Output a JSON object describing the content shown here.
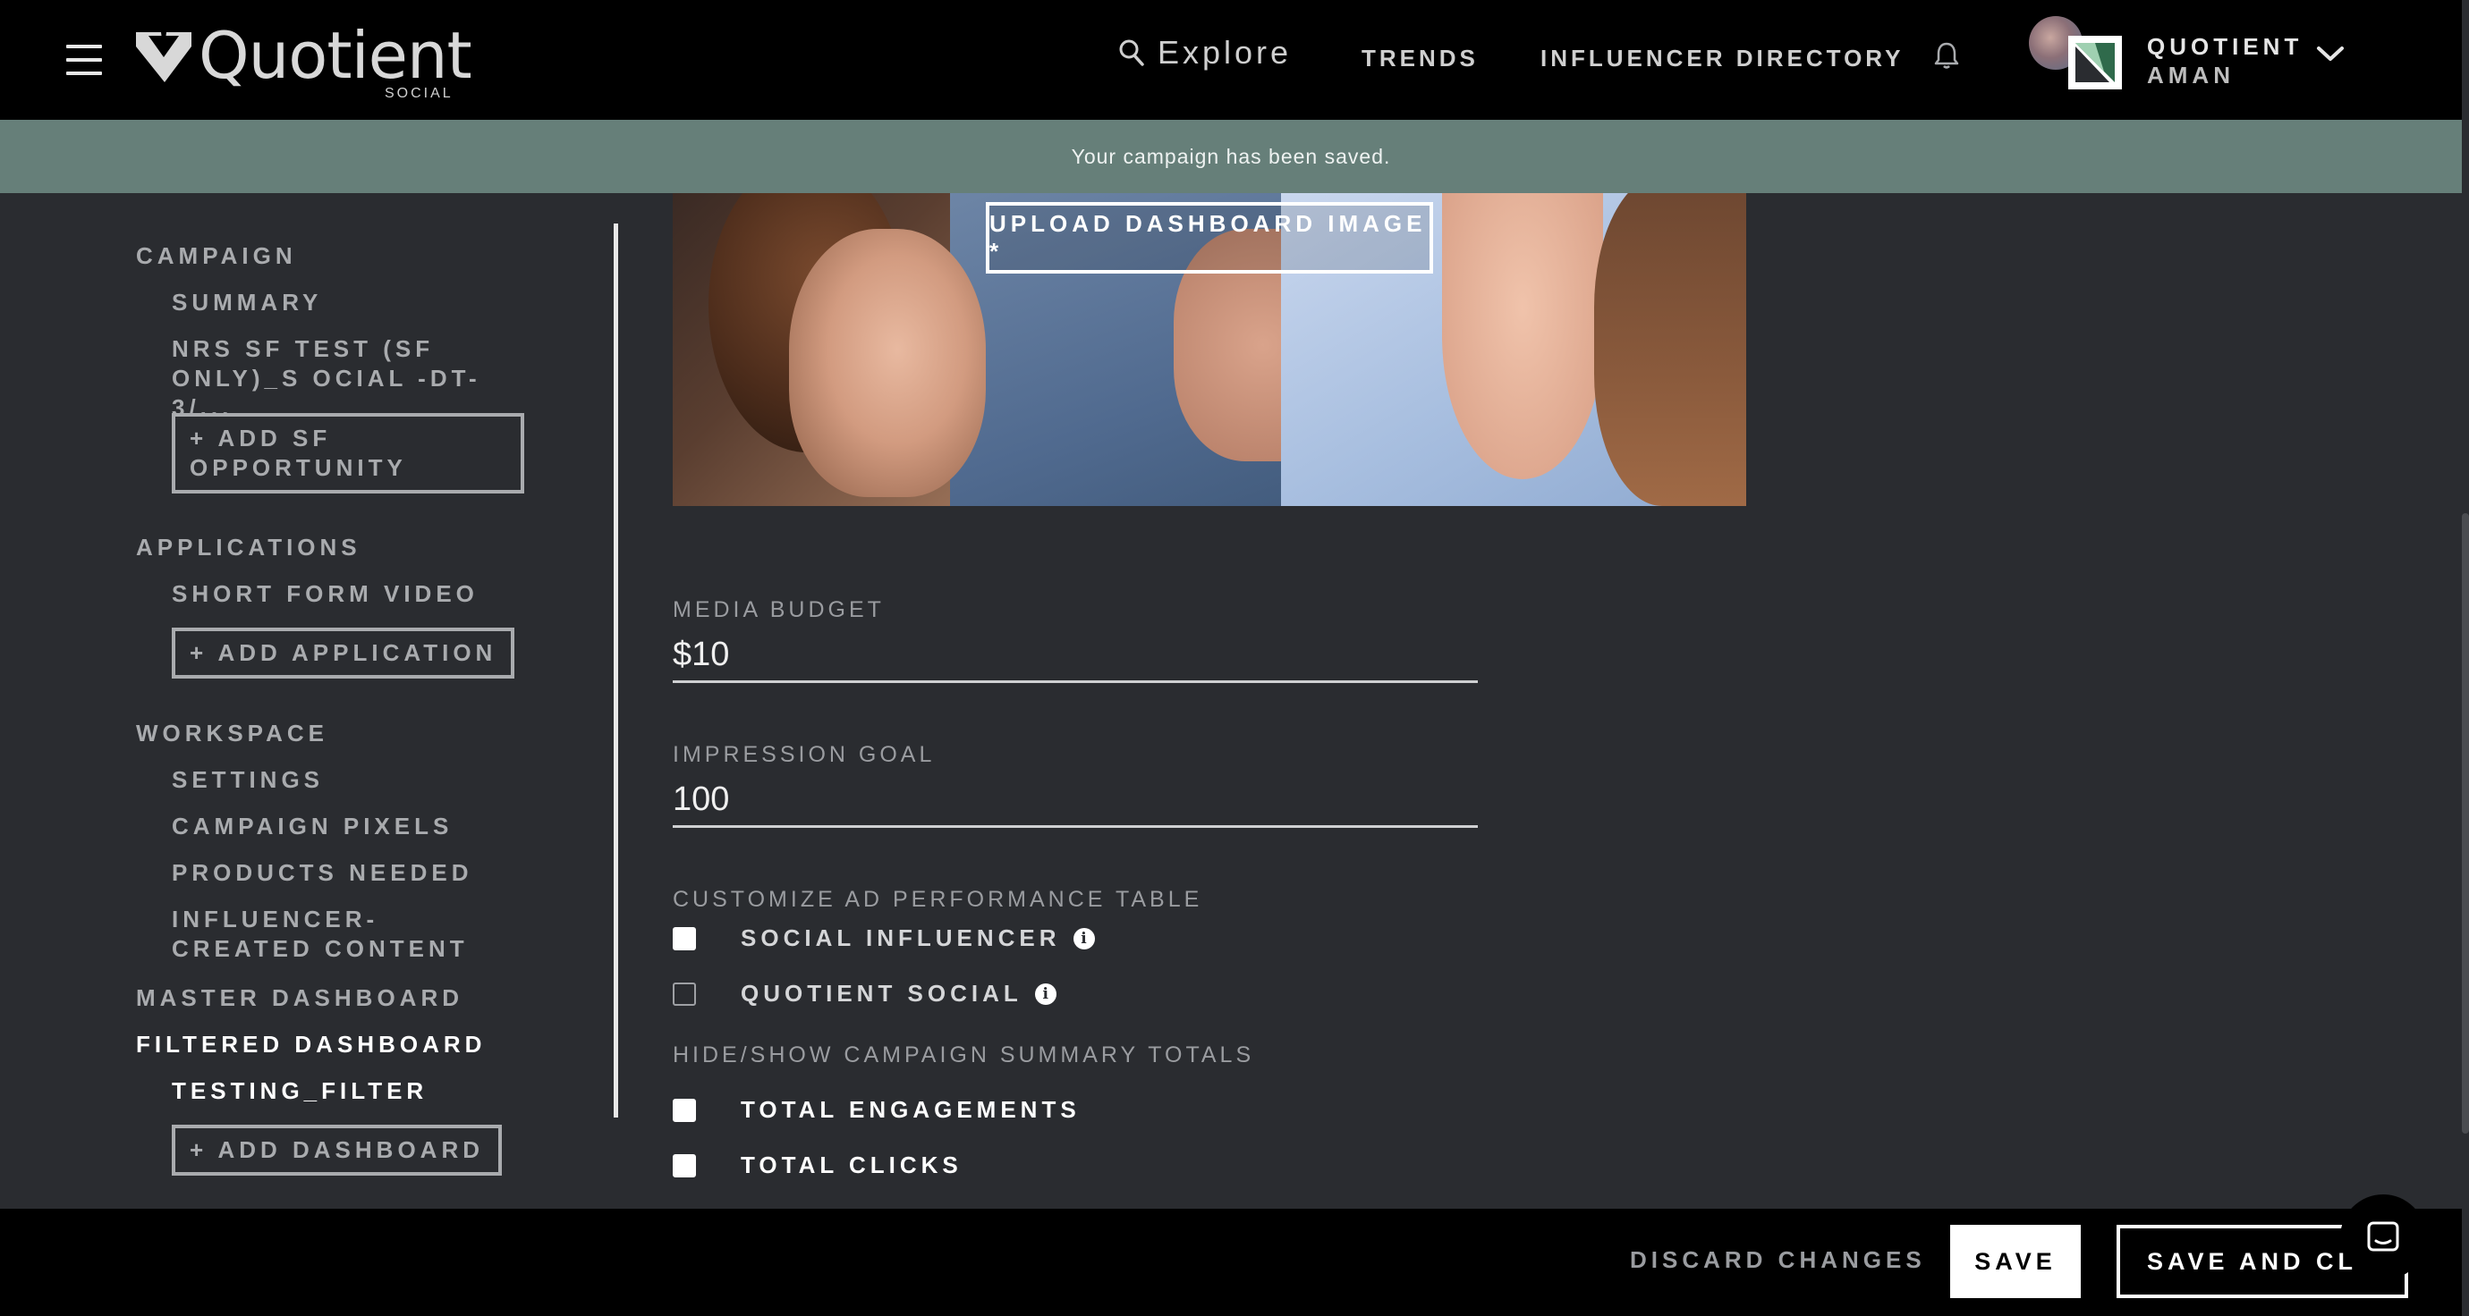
{
  "header": {
    "logo_text": "Quotient",
    "logo_sub": "SOCIAL",
    "search_label": "Explore",
    "nav": [
      {
        "label": "TRENDS"
      },
      {
        "label": "INFLUENCER DIRECTORY"
      }
    ],
    "user": {
      "line1": "QUOTIENT",
      "line2": "AMAN"
    },
    "icons": [
      "hamburger-icon",
      "search-icon",
      "bell-icon",
      "chevron-down-icon"
    ]
  },
  "banner": {
    "message": "Your campaign has been saved."
  },
  "sidebar": {
    "campaign": {
      "heading": "CAMPAIGN",
      "items": [
        "SUMMARY",
        "NRS SF TEST (SF ONLY)_S OCIAL -DT-3/..."
      ],
      "button": "+ ADD SF OPPORTUNITY"
    },
    "applications": {
      "heading": "APPLICATIONS",
      "items": [
        "SHORT FORM VIDEO"
      ],
      "button": "+ ADD APPLICATION"
    },
    "workspace": {
      "heading": "WORKSPACE",
      "items": [
        "SETTINGS",
        "CAMPAIGN PIXELS",
        "PRODUCTS NEEDED",
        "INFLUENCER-CREATED CONTENT"
      ]
    },
    "master_dashboard": "MASTER DASHBOARD",
    "filtered_dashboard": {
      "heading": "FILTERED DASHBOARD",
      "items": [
        "TESTING_FILTER"
      ],
      "button": "+ ADD DASHBOARD"
    }
  },
  "main": {
    "upload_button": "UPLOAD DASHBOARD IMAGE *",
    "media_budget": {
      "label": "MEDIA BUDGET",
      "value": "$10"
    },
    "impression_goal": {
      "label": "IMPRESSION GOAL",
      "value": "100"
    },
    "ad_table": {
      "label": "CUSTOMIZE AD PERFORMANCE TABLE",
      "options": [
        {
          "label": "SOCIAL INFLUENCER",
          "checked": true
        },
        {
          "label": "QUOTIENT SOCIAL",
          "checked": false
        }
      ]
    },
    "summary_totals": {
      "label": "HIDE/SHOW CAMPAIGN SUMMARY TOTALS",
      "options": [
        {
          "label": "TOTAL ENGAGEMENTS",
          "checked": true
        },
        {
          "label": "TOTAL CLICKS",
          "checked": true
        }
      ]
    }
  },
  "footer": {
    "discard": "DISCARD CHANGES",
    "save": "SAVE",
    "save_close": "SAVE AND CLOSE"
  },
  "colors": {
    "header_bg": "#000000",
    "banner_bg": "#667f79",
    "page_bg": "#2a2c30",
    "muted_text": "#a9abae"
  }
}
